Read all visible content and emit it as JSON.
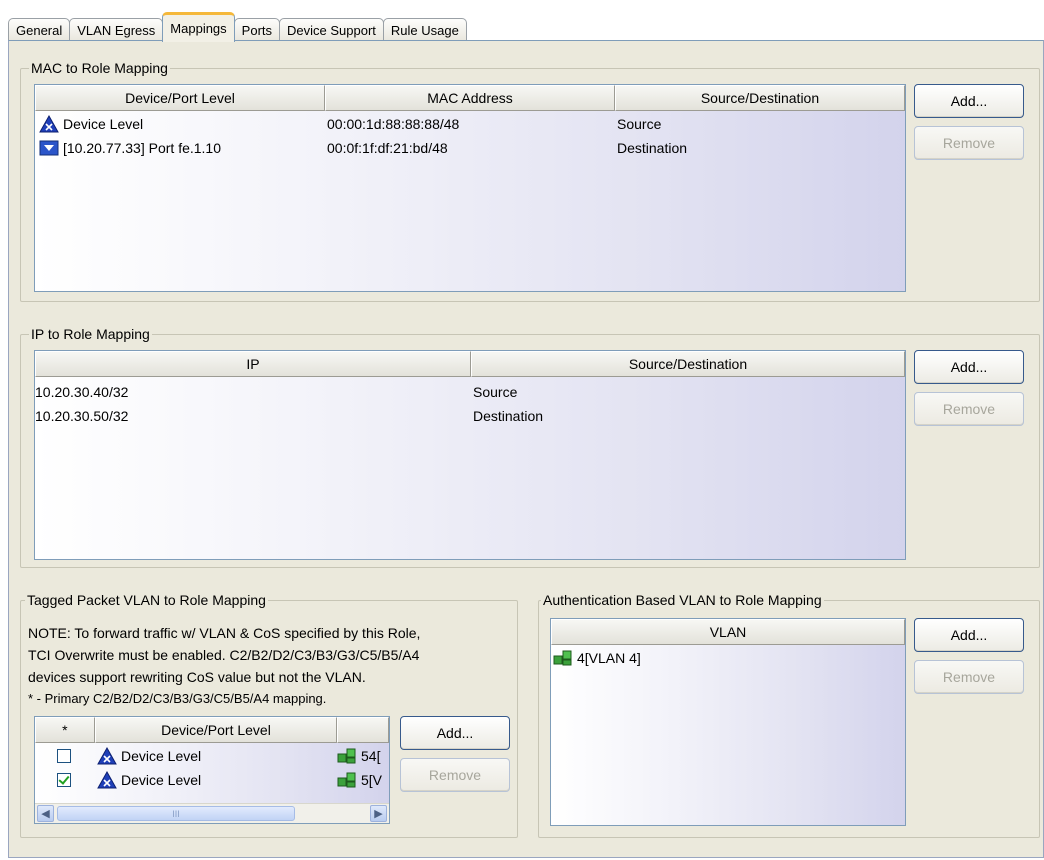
{
  "tabs": [
    {
      "label": "General",
      "active": false
    },
    {
      "label": "VLAN Egress",
      "active": false
    },
    {
      "label": "Mappings",
      "active": true
    },
    {
      "label": "Ports",
      "active": false
    },
    {
      "label": "Device Support",
      "active": false
    },
    {
      "label": "Rule Usage",
      "active": false
    }
  ],
  "mac_mapping": {
    "title": "MAC to Role Mapping",
    "columns": [
      "Device/Port Level",
      "MAC Address",
      "Source/Destination"
    ],
    "rows": [
      {
        "level": "Device Level",
        "icon": "device-level-icon",
        "mac": "00:00:1d:88:88:88/48",
        "direction": "Source"
      },
      {
        "level": "[10.20.77.33] Port fe.1.10",
        "icon": "port-icon",
        "mac": "00:0f:1f:df:21:bd/48",
        "direction": "Destination"
      }
    ],
    "add_label": "Add...",
    "remove_label": "Remove"
  },
  "ip_mapping": {
    "title": "IP to Role Mapping",
    "columns": [
      "IP",
      "Source/Destination"
    ],
    "rows": [
      {
        "ip": "10.20.30.40/32",
        "direction": "Source"
      },
      {
        "ip": "10.20.30.50/32",
        "direction": "Destination"
      }
    ],
    "add_label": "Add...",
    "remove_label": "Remove"
  },
  "tagged_mapping": {
    "title": "Tagged Packet VLAN to Role Mapping",
    "note_lines": [
      "NOTE: To forward traffic w/ VLAN & CoS specified by this Role,",
      "TCI Overwrite must be enabled. C2/B2/D2/C3/B3/G3/C5/B5/A4",
      "devices support rewriting CoS value but not the VLAN.",
      "* - Primary C2/B2/D2/C3/B3/G3/C5/B5/A4 mapping."
    ],
    "columns": [
      "*",
      "Device/Port Level",
      ""
    ],
    "rows": [
      {
        "checked": false,
        "level": "Device Level",
        "vlan": "54["
      },
      {
        "checked": true,
        "level": "Device Level",
        "vlan": "5[V"
      }
    ],
    "scroll_thumb_glyph": "III",
    "add_label": "Add...",
    "remove_label": "Remove"
  },
  "auth_mapping": {
    "title": "Authentication Based VLAN to Role Mapping",
    "columns": [
      "VLAN"
    ],
    "rows": [
      {
        "vlan": "4[VLAN 4]"
      }
    ],
    "add_label": "Add...",
    "remove_label": "Remove"
  }
}
